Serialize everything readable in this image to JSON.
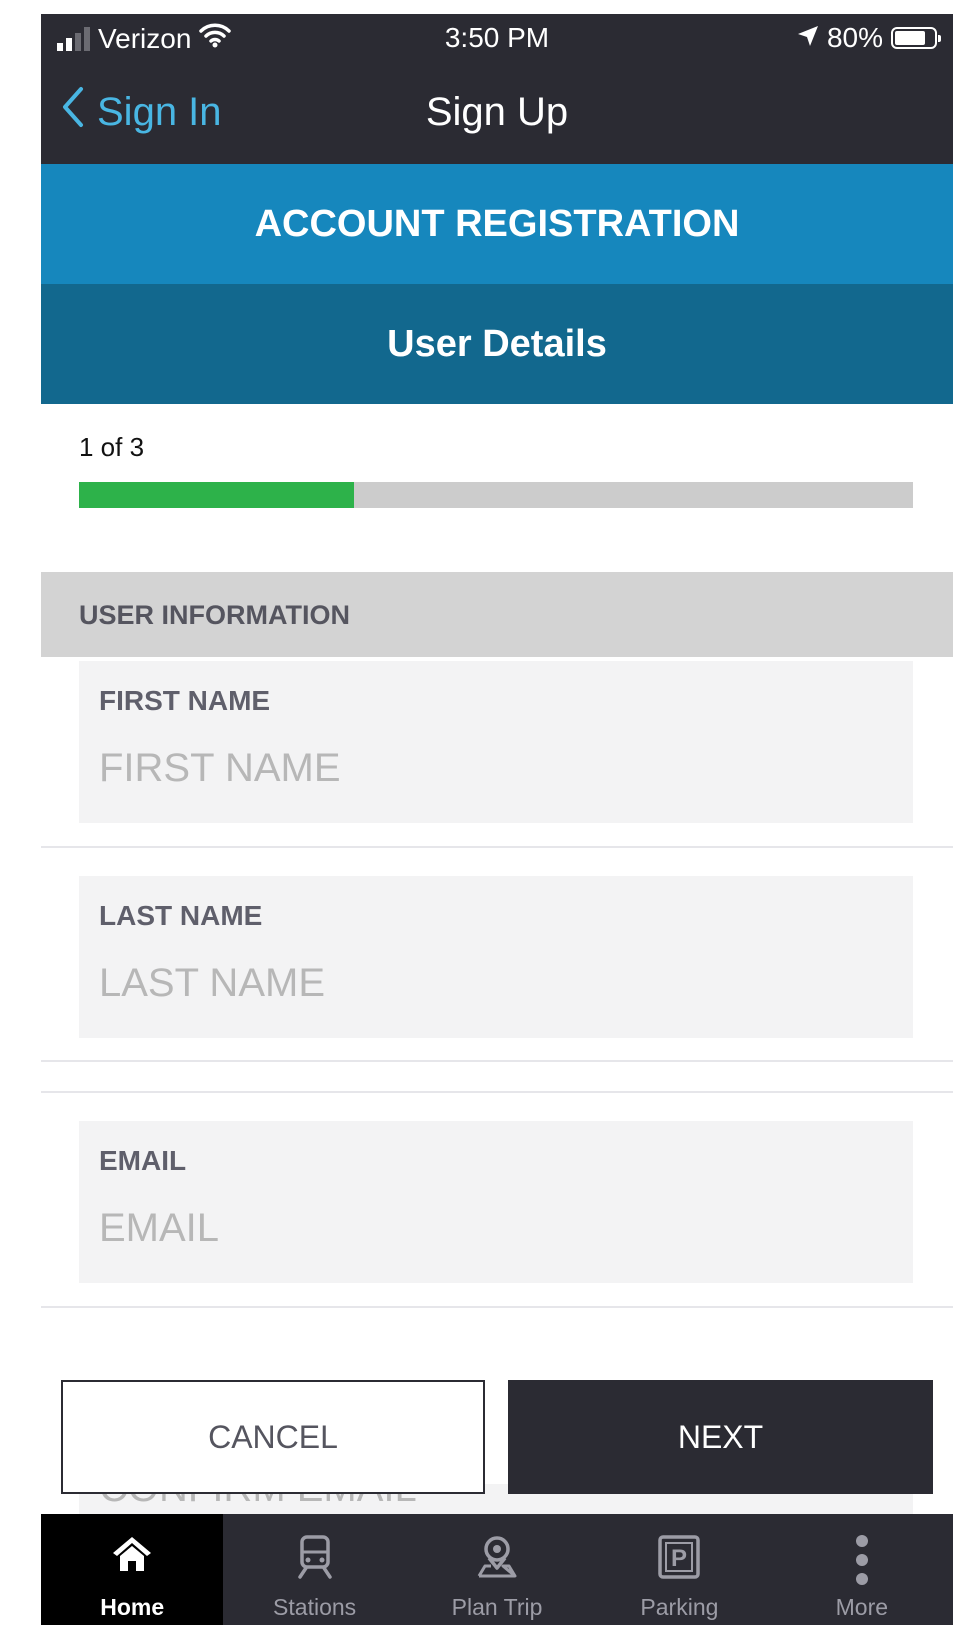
{
  "status_bar": {
    "carrier": "Verizon",
    "time": "3:50 PM",
    "battery_percent": "80%",
    "battery_level": 0.8,
    "signal_bars_active": 2,
    "icons": [
      "signal-icon",
      "wifi-icon",
      "location-arrow-icon",
      "battery-icon"
    ]
  },
  "nav": {
    "back_label": "Sign In",
    "title": "Sign Up"
  },
  "banner": {
    "title": "ACCOUNT REGISTRATION",
    "subtitle": "User Details"
  },
  "progress": {
    "step_text": "1 of 3",
    "fraction": 0.33,
    "fill_color": "#2db24a",
    "track_color": "#cccccc"
  },
  "section": {
    "title": "USER INFORMATION"
  },
  "form": {
    "first_name": {
      "label": "FIRST NAME",
      "placeholder": "FIRST NAME",
      "value": ""
    },
    "last_name": {
      "label": "LAST NAME",
      "placeholder": "LAST NAME",
      "value": ""
    },
    "email": {
      "label": "EMAIL",
      "placeholder": "EMAIL",
      "value": ""
    },
    "confirm_email": {
      "placeholder": "CONFIRM EMAIL"
    }
  },
  "actions": {
    "cancel_label": "CANCEL",
    "next_label": "NEXT"
  },
  "tabs": [
    {
      "label": "Home",
      "icon": "home-icon",
      "active": true
    },
    {
      "label": "Stations",
      "icon": "train-icon",
      "active": false
    },
    {
      "label": "Plan Trip",
      "icon": "map-pin-icon",
      "active": false
    },
    {
      "label": "Parking",
      "icon": "parking-icon",
      "active": false
    },
    {
      "label": "More",
      "icon": "more-vertical-icon",
      "active": false
    }
  ],
  "colors": {
    "dark": "#2b2b33",
    "accent_blue": "#1687bd",
    "dark_blue": "#12688e",
    "link_blue": "#49b6e3"
  }
}
